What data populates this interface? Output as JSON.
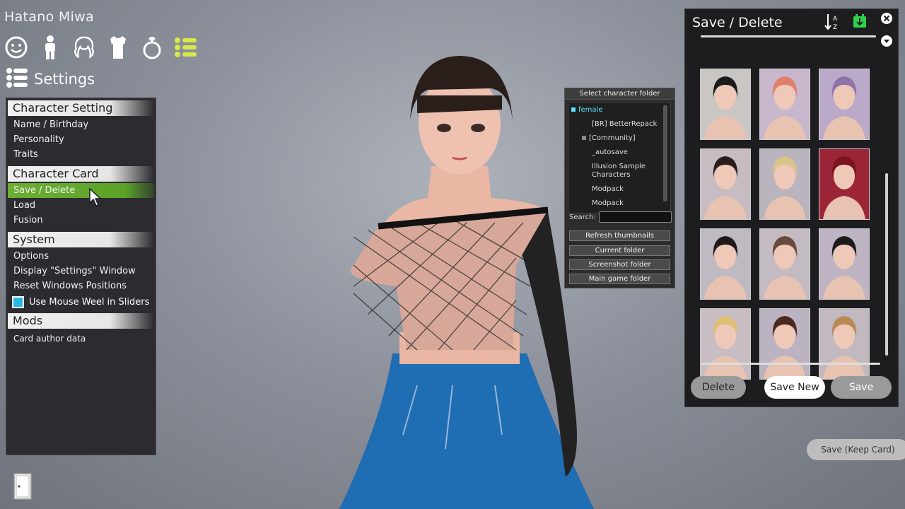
{
  "character_name": "Hatano Miwa",
  "category_icons": [
    "face-icon",
    "body-icon",
    "hair-icon",
    "clothes-icon",
    "accessory-icon",
    "list-icon"
  ],
  "settings": {
    "title": "Settings"
  },
  "menu": {
    "character_setting": {
      "header": "Character Setting",
      "items": [
        "Name / Birthday",
        "Personality",
        "Traits"
      ]
    },
    "character_card": {
      "header": "Character Card",
      "items": [
        "Save / Delete",
        "Load",
        "Fusion"
      ],
      "active": "Save / Delete"
    },
    "system": {
      "header": "System",
      "items": [
        "Options",
        "Display \"Settings\" Window",
        "Reset Windows Positions"
      ],
      "checkbox_label": "Use Mouse Weel in Sliders",
      "checkbox_checked": true
    },
    "mods": {
      "header": "Mods",
      "items": [
        "Card author data"
      ]
    }
  },
  "folder_panel": {
    "title": "Select character folder",
    "folders": [
      "female",
      "[BR] BetterRepack",
      "[Community]",
      "_autosave",
      "Illusion Sample Characters",
      "Modpack",
      "Modpack"
    ],
    "search_label": "Search:",
    "search_value": "",
    "buttons": [
      "Refresh thumbnails",
      "Current folder",
      "Screenshot folder",
      "Main game folder"
    ]
  },
  "save_panel": {
    "title": "Save / Delete",
    "icons": [
      "sort-az-icon",
      "save-folder-icon",
      "close-icon",
      "dropdown-icon"
    ],
    "thumbnail_count": 12,
    "buttons": {
      "delete": "Delete",
      "save_new": "Save New",
      "save": "Save"
    }
  },
  "save_keep_card": "Save (Keep Card)",
  "colors": {
    "accent_green": "#5aa328",
    "checkbox_blue": "#27b8e8",
    "panel_bg": "#2b2b30"
  }
}
